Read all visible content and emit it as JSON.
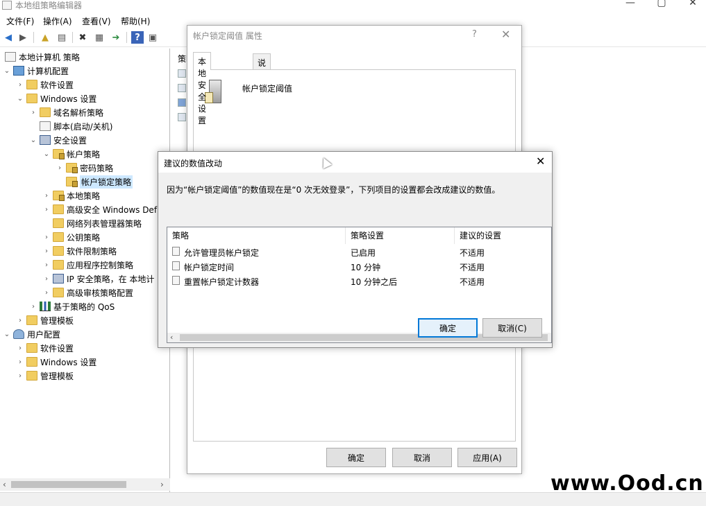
{
  "window": {
    "title": "本地组策略编辑器",
    "minimize": "—",
    "maximize": "▢",
    "close": "✕"
  },
  "menu": [
    "文件(F)",
    "操作(A)",
    "查看(V)",
    "帮助(H)"
  ],
  "tree": {
    "root": "本地计算机 策略",
    "items": [
      "计算机配置",
      "软件设置",
      "Windows 设置",
      "域名解析策略",
      "脚本(启动/关机)",
      "安全设置",
      "帐户策略",
      "密码策略",
      "帐户锁定策略",
      "本地策略",
      "高级安全 Windows Def",
      "网络列表管理器策略",
      "公钥策略",
      "软件限制策略",
      "应用程序控制策略",
      "IP 安全策略，在 本地计",
      "高级审核策略配置",
      "基于策略的 QoS",
      "管理模板",
      "用户配置",
      "软件设置",
      "Windows 设置",
      "管理模板"
    ]
  },
  "right_pane": {
    "column_header": "策略"
  },
  "prop_dialog": {
    "title": "帐户锁定阈值 属性",
    "help": "?",
    "close": "✕",
    "tabs": [
      "本地安全设置",
      "说明"
    ],
    "policy_name": "帐户锁定阈值",
    "ok": "确定",
    "cancel": "取消",
    "apply": "应用(A)"
  },
  "sugg_dialog": {
    "title": "建议的数值改动",
    "close": "✕",
    "message": "因为“帐户锁定阈值”的数值现在是“0 次无效登录”，下列项目的设置都会改成建议的数值。",
    "columns": [
      "策略",
      "策略设置",
      "建议的设置"
    ],
    "rows": [
      {
        "policy": "允许管理员帐户锁定",
        "setting": "已启用",
        "suggested": "不适用"
      },
      {
        "policy": "帐户锁定时间",
        "setting": "10 分钟",
        "suggested": "不适用"
      },
      {
        "policy": "重置帐户锁定计数器",
        "setting": "10 分钟之后",
        "suggested": "不适用"
      }
    ],
    "ok": "确定",
    "cancel": "取消(C)"
  },
  "watermark": "www.Ood.cn"
}
